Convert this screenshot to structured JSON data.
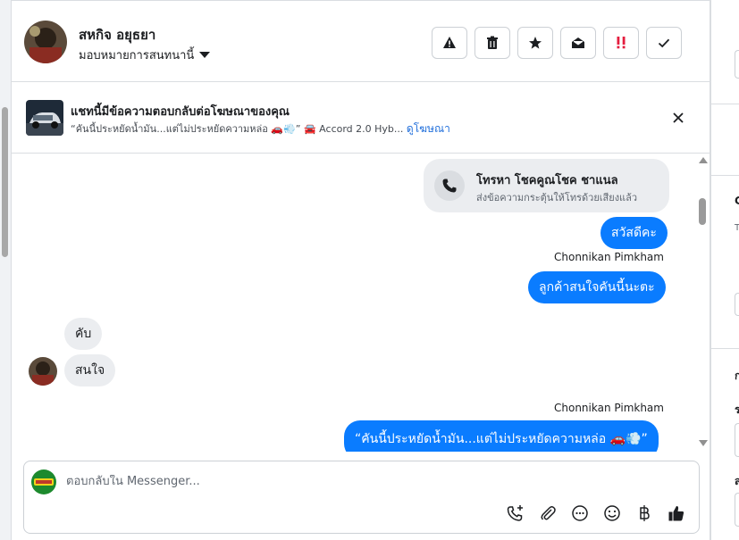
{
  "header": {
    "contact_name": "สหกิจ อยุธยา",
    "assign_label": "มอบหมายการสนทนานี้",
    "actions": [
      "report-icon",
      "trash-icon",
      "star-icon",
      "mark-unread-icon",
      "important-icon",
      "done-icon"
    ]
  },
  "ad_banner": {
    "title": "แชทนี้มีข้อความตอบกลับต่อโฆษณาของคุณ",
    "subtitle": "“คันนี้ประหยัดน้ำมัน...แต่ไม่ประหยัดความหล่อ 🚗💨” 🚘 Accord 2.0 Hyb...",
    "link": "ดูโฆษณา"
  },
  "messages": {
    "call_card": {
      "title": "โทรหา โชคคูณโชค ชาแนล",
      "subtitle": "ส่งข้อความกระตุ้นให้โทรด้วยเสียงแล้ว"
    },
    "greeting": "สวัสดีคะ",
    "sender_1": "Chonnikan Pimkham",
    "interest_q": "ลูกค้าสนใจคันนี้นะตะ",
    "reply_1": "คับ",
    "reply_2": "สนใจ",
    "sender_2": "Chonnikan Pimkham",
    "ad_quote": "“คันนี้ประหยัดน้ำมัน...แต่ไม่ประหยัดความหล่อ 🚗💨”"
  },
  "composer": {
    "placeholder": "ตอบกลับใน Messenger...",
    "tools": [
      "add-call-icon",
      "attach-icon",
      "saved-reply-icon",
      "emoji-icon",
      "baht-icon",
      "thumbs-up-icon"
    ]
  },
  "right_panel": {
    "chars": [
      "C",
      "T",
      "ก",
      "ร",
      "ส"
    ]
  },
  "colors": {
    "accent": "#0a7cff",
    "important": "#e41e3f",
    "link": "#216fdb"
  }
}
